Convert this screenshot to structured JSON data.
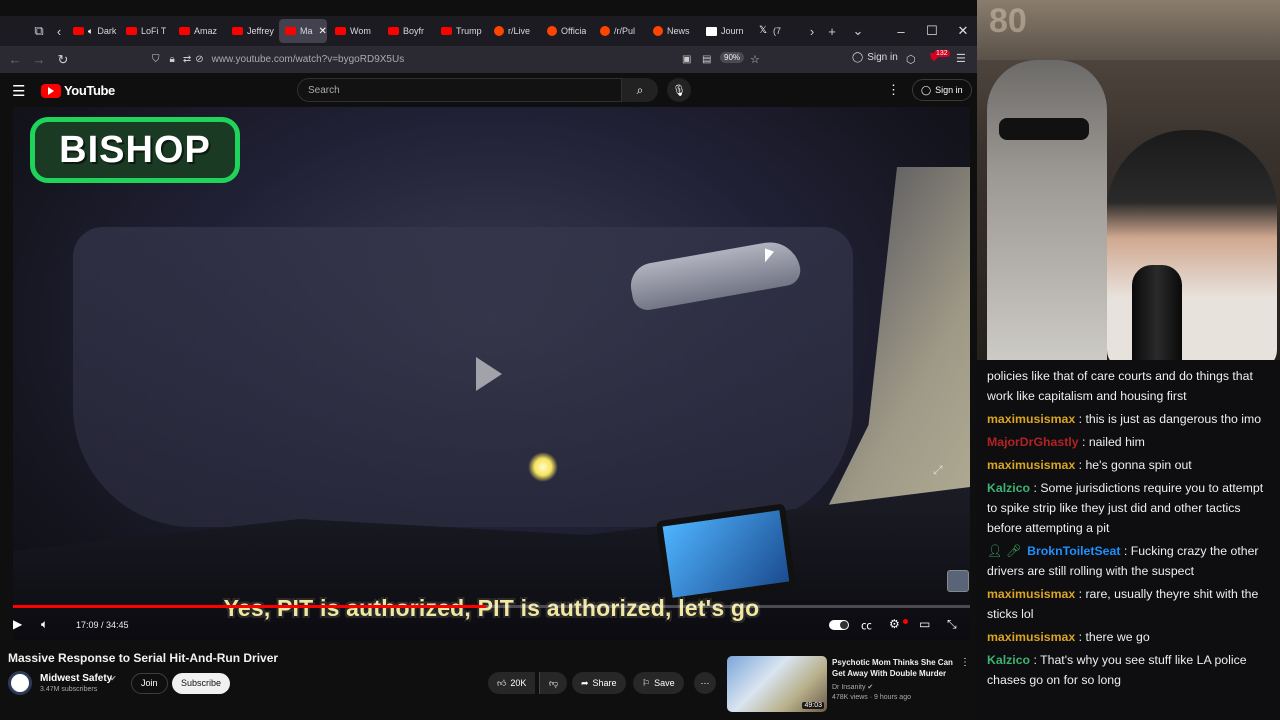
{
  "browser": {
    "tabs": [
      {
        "label": "Dark S",
        "favicon": "youtube",
        "audio": true
      },
      {
        "label": "LoFi T",
        "favicon": "youtube"
      },
      {
        "label": "Amaz",
        "favicon": "youtube"
      },
      {
        "label": "Jeffrey",
        "favicon": "youtube"
      },
      {
        "label": "Ma",
        "favicon": "youtube",
        "active": true
      },
      {
        "label": "Wom",
        "favicon": "youtube"
      },
      {
        "label": "Boyfr",
        "favicon": "youtube"
      },
      {
        "label": "Trump",
        "favicon": "youtube"
      },
      {
        "label": "r/Live",
        "favicon": "reddit"
      },
      {
        "label": "Officia",
        "favicon": "reddit"
      },
      {
        "label": "/r/Pul",
        "favicon": "reddit"
      },
      {
        "label": "News",
        "favicon": "reddit"
      },
      {
        "label": "Journ",
        "favicon": "ap"
      },
      {
        "label": "(7",
        "favicon": "x"
      }
    ],
    "url": "www.youtube.com/watch?v=bygoRD9X5Us",
    "zoom": "90%",
    "sign_in": "Sign in",
    "extension_badge": "132"
  },
  "youtube": {
    "logo_text": "YouTube",
    "search_placeholder": "Search",
    "sign_in": "Sign in"
  },
  "player": {
    "watermark": "BISHOP",
    "subtitle": "Yes, PIT is authorized, PIT is authorized, let's go",
    "current_time": "17:09",
    "duration": "34:45",
    "time_display": "17:09 / 34:45",
    "progress_fraction": 0.494
  },
  "video": {
    "title": "Massive Response to Serial Hit-And-Run Driver",
    "channel": "Midwest Safety",
    "subscribers": "3.47M subscribers",
    "join_label": "Join",
    "subscribe_label": "Subscribe",
    "likes": "20K",
    "share_label": "Share",
    "save_label": "Save"
  },
  "recommendation": {
    "title": "Psychotic Mom Thinks She Can Get Away With Double Murder",
    "channel": "Dr Insanity",
    "meta": "478K views · 9 hours ago",
    "duration": "49:03"
  },
  "chat": [
    {
      "user": "",
      "text": "policies like that of care courts and do things that work like capitalism and housing first",
      "color": "#efeff1"
    },
    {
      "user": "maximusismax",
      "text": "this is just as dangerous tho imo",
      "color": "#daa520"
    },
    {
      "user": "MajorDrGhastly",
      "text": "nailed him",
      "color": "#b22222"
    },
    {
      "user": "maximusismax",
      "text": "he's gonna spin out",
      "color": "#daa520"
    },
    {
      "user": "Kalzico",
      "text": "Some jurisdictions require you to attempt to spike strip like they just did and other tactics before attempting a pit",
      "color": "#3cb371"
    },
    {
      "user": "BroknToiletSeat",
      "text": "Fucking crazy the other drivers are still rolling with the suspect",
      "color": "#1e90ff",
      "badges": true
    },
    {
      "user": "maximusismax",
      "text": "rare, usually theyre shit with the sticks lol",
      "color": "#daa520"
    },
    {
      "user": "maximusismax",
      "text": "there we go",
      "color": "#daa520"
    },
    {
      "user": "Kalzico",
      "text": "That's why you see stuff like LA police chases go on for so long",
      "color": "#3cb371"
    }
  ],
  "colors": {
    "youtube_red": "#ff0000",
    "watermark_green": "#1fd45a",
    "subtitle_yellow": "#f1e7a1"
  }
}
